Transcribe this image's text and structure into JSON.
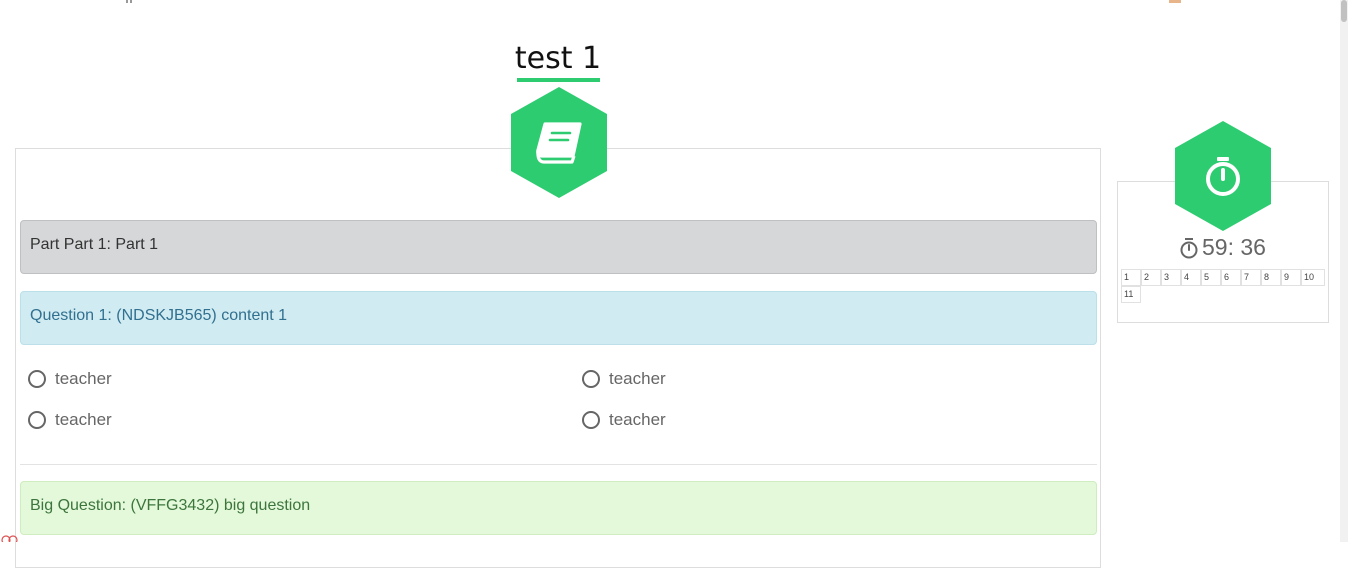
{
  "test": {
    "title": "test 1"
  },
  "part": {
    "label": "Part Part 1: Part 1"
  },
  "question": {
    "label": "Question 1: (NDSKJB565) content 1",
    "options": [
      "teacher",
      "teacher",
      "teacher",
      "teacher"
    ]
  },
  "big_question": {
    "label": "Big Question: (VFFG3432) big question"
  },
  "timer": {
    "value": "59: 36"
  },
  "navigator": {
    "numbers": [
      "1",
      "2",
      "3",
      "4",
      "5",
      "6",
      "7",
      "8",
      "9",
      "10",
      "11"
    ]
  },
  "icons": {
    "book": "book-icon",
    "stopwatch": "stopwatch-icon"
  },
  "colors": {
    "accent": "#2ecc71",
    "part_bg": "#d6d7d9",
    "question_bg": "#d0ebf2",
    "big_question_bg": "#e4f8da"
  }
}
